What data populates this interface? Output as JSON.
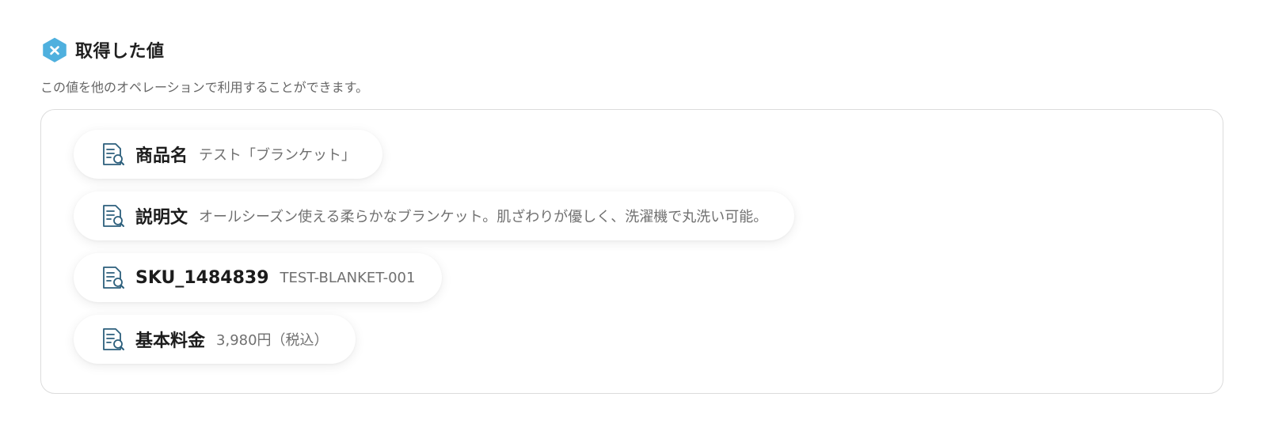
{
  "header": {
    "title": "取得した値",
    "logo_icon": "x-pentagon-icon",
    "accent_color": "#4fb0de"
  },
  "description": "この値を他のオペレーションで利用することができます。",
  "values": [
    {
      "key": "商品名",
      "value": "テスト「ブランケット」",
      "icon": "document-search-icon"
    },
    {
      "key": "説明文",
      "value": "オールシーズン使える柔らかなブランケット。肌ざわりが優しく、洗濯機で丸洗い可能。",
      "icon": "document-search-icon"
    },
    {
      "key": "SKU_1484839",
      "value": "TEST-BLANKET-001",
      "icon": "document-search-icon"
    },
    {
      "key": "基本料金",
      "value": "3,980円（税込）",
      "icon": "document-search-icon"
    }
  ]
}
